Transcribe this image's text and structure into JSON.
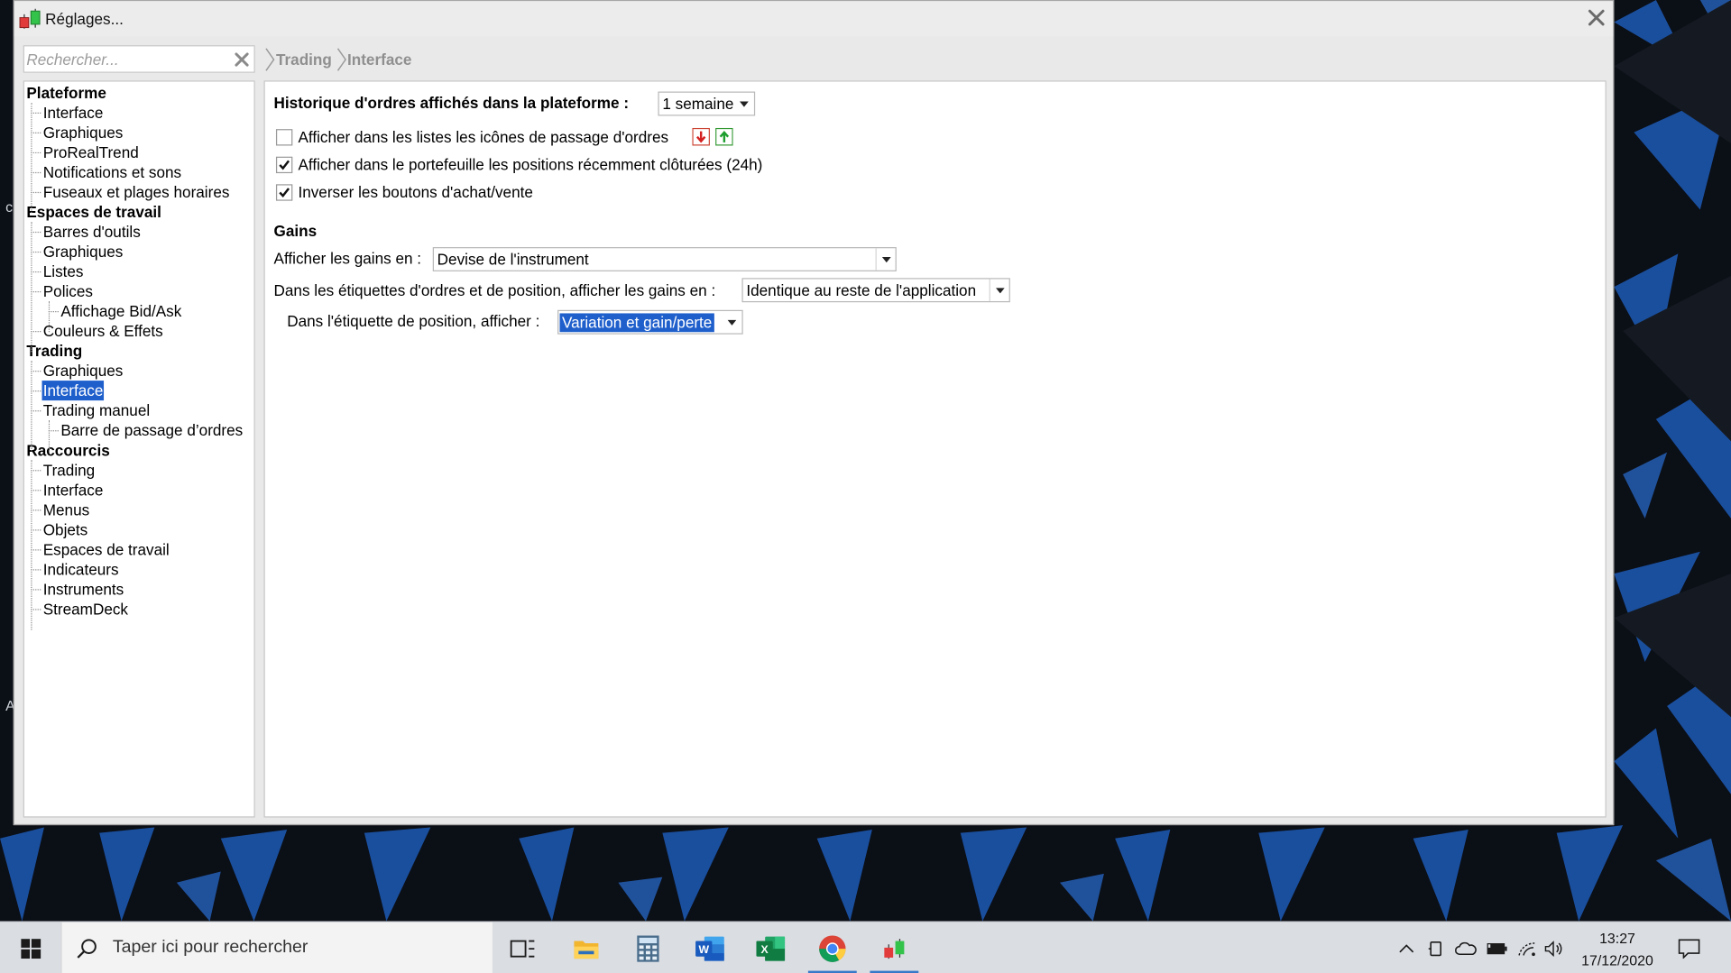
{
  "window": {
    "title": "Réglages...",
    "search_placeholder": "Rechercher...",
    "breadcrumb": [
      "Trading",
      "Interface"
    ]
  },
  "tree": [
    {
      "label": "Plateforme",
      "level": 0
    },
    {
      "label": "Interface",
      "level": 1
    },
    {
      "label": "Graphiques",
      "level": 1
    },
    {
      "label": "ProRealTrend",
      "level": 1
    },
    {
      "label": "Notifications et sons",
      "level": 1
    },
    {
      "label": "Fuseaux et plages horaires",
      "level": 1
    },
    {
      "label": "Espaces de travail",
      "level": 0
    },
    {
      "label": "Barres d'outils",
      "level": 1
    },
    {
      "label": "Graphiques",
      "level": 1
    },
    {
      "label": "Listes",
      "level": 1
    },
    {
      "label": "Polices",
      "level": 1
    },
    {
      "label": "Affichage Bid/Ask",
      "level": 2
    },
    {
      "label": "Couleurs & Effets",
      "level": 1
    },
    {
      "label": "Trading",
      "level": 0
    },
    {
      "label": "Graphiques",
      "level": 1
    },
    {
      "label": "Interface",
      "level": 1,
      "selected": true
    },
    {
      "label": "Trading manuel",
      "level": 1
    },
    {
      "label": "Barre de passage d’ordres",
      "level": 2
    },
    {
      "label": "Raccourcis",
      "level": 0
    },
    {
      "label": "Trading",
      "level": 1
    },
    {
      "label": "Interface",
      "level": 1
    },
    {
      "label": "Menus",
      "level": 1
    },
    {
      "label": "Objets",
      "level": 1
    },
    {
      "label": "Espaces de travail",
      "level": 1
    },
    {
      "label": "Indicateurs",
      "level": 1
    },
    {
      "label": "Instruments",
      "level": 1
    },
    {
      "label": "StreamDeck",
      "level": 1
    }
  ],
  "panel": {
    "history_label": "Historique d'ordres affichés dans la plateforme :",
    "history_value": "1 semaine",
    "options": [
      {
        "label": "Afficher dans les listes les icônes de passage d'ordres",
        "checked": false
      },
      {
        "label": "Afficher dans le portefeuille les positions récemment clôturées (24h)",
        "checked": true
      },
      {
        "label": "Inverser les boutons d'achat/vente",
        "checked": true
      }
    ],
    "gains_heading": "Gains",
    "gains_unit_label": "Afficher les gains en :",
    "gains_unit_value": "Devise de l'instrument",
    "labels_gains_label": "Dans les étiquettes d'ordres et de position, afficher les gains en :",
    "labels_gains_value": "Identique au reste de l'application",
    "position_label_label": "Dans l'étiquette de position, afficher :",
    "position_label_value": "Variation et gain/perte"
  },
  "taskbar": {
    "search_placeholder": "Taper ici pour rechercher",
    "time": "13:27",
    "date": "17/12/2020",
    "apps": [
      "task-view",
      "file-explorer",
      "calculator",
      "word",
      "excel",
      "chrome",
      "prorealtime"
    ]
  },
  "colors": {
    "selection": "#1f5fcc",
    "wallpaper_accent": "#1f63c9"
  }
}
